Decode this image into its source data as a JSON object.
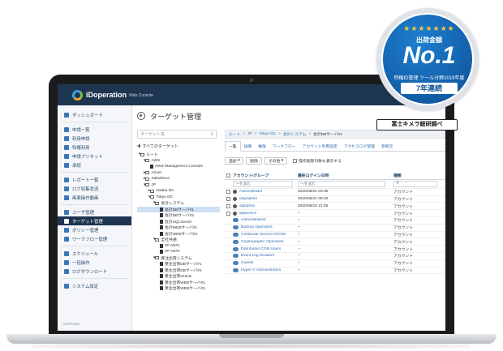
{
  "app": {
    "logo_text": "iDoperation",
    "logo_sub": "Web Console",
    "page_title": "ターゲット管理"
  },
  "sidebar": {
    "items": [
      {
        "label": "ダッシュボード"
      },
      {
        "label": "申請一覧"
      },
      {
        "label": "利用申請"
      },
      {
        "label": "特権利用"
      },
      {
        "label": "申請プリセット"
      },
      {
        "label": "承認"
      },
      {
        "label": "レポート一覧"
      },
      {
        "label": "ログ収集状況"
      },
      {
        "label": "画面操作動画"
      },
      {
        "label": "ユーザ管理"
      },
      {
        "label": "ターゲット管理"
      },
      {
        "label": "ポリシー管理"
      },
      {
        "label": "ワークフロー管理"
      },
      {
        "label": "スケジュール"
      },
      {
        "label": "一括操作"
      },
      {
        "label": "ログダウンロード"
      },
      {
        "label": "システム設定"
      }
    ],
    "footer": "Asia/Tokyo"
  },
  "tree": {
    "search_placeholder": "ターゲット名",
    "all_targets": "すべてのターゲット",
    "rows": [
      {
        "label": "ルート"
      },
      {
        "label": "AWS"
      },
      {
        "label": "AWS Management Console"
      },
      {
        "label": "Azure"
      },
      {
        "label": "Salesforce"
      },
      {
        "label": "JP"
      },
      {
        "label": "Osaka DC"
      },
      {
        "label": "Tokyo DC"
      },
      {
        "label": "会計システム"
      },
      {
        "label": "会計DBサーバ#1"
      },
      {
        "label": "会計DBサーバ#2"
      },
      {
        "label": "会計SQLServer"
      },
      {
        "label": "会計WEBサーバ#1"
      },
      {
        "label": "会計WEBサーバ#2"
      },
      {
        "label": "全社共通"
      },
      {
        "label": "JP AD#1"
      },
      {
        "label": "JP AD#2"
      },
      {
        "label": "受注出荷システム"
      },
      {
        "label": "受注出荷DBサーバ#1"
      },
      {
        "label": "受注出荷DBサーバ#2"
      },
      {
        "label": "受注出荷Oracle"
      },
      {
        "label": "受注出荷WEBサーバ#1"
      },
      {
        "label": "受注出荷WEBサーバ#2"
      }
    ]
  },
  "breadcrumb": [
    "ルート",
    "JP",
    "Tokyo DC",
    "会計システム",
    "会計DBサーバ#1"
  ],
  "tabs": [
    "一覧",
    "詳細",
    "権限",
    "ワークフロー",
    "アカウント利用設定",
    "アクセスログ管理",
    "参照元"
  ],
  "toolbar": {
    "add": "追加",
    "delete": "削除",
    "other": "その他",
    "show_deleted": "操作削除対象も表示する"
  },
  "grid": {
    "headers": [
      "アカウント/グループ",
      "最終ログイン日時",
      "種類"
    ],
    "filter_placeholder": "〜を含む",
    "filter_placeholder_2": "〜を含む",
    "rows": [
      {
        "name": "Administrator",
        "date": "2020/08/21 03:35",
        "type": "アカウント"
      },
      {
        "name": "idopadmin",
        "date": "2020/08/21 08:30",
        "type": "アカウント"
      },
      {
        "name": "sqladmin",
        "date": "2020/08/15 21:05",
        "type": "アカウント"
      },
      {
        "name": "sqlservice",
        "date": "--",
        "type": "アカウント"
      },
      {
        "name": "Administrators",
        "date": "--",
        "type": "アカウント"
      },
      {
        "name": "Backup Operators",
        "date": "--",
        "type": "アカウント"
      },
      {
        "name": "Certificate Service DCOM",
        "date": "--",
        "type": "アカウント"
      },
      {
        "name": "Cryptographic Operators",
        "date": "--",
        "type": "アカウント"
      },
      {
        "name": "Distributed COM Users",
        "date": "--",
        "type": "アカウント"
      },
      {
        "name": "Event Log Readers",
        "date": "--",
        "type": "アカウント"
      },
      {
        "name": "Guests",
        "date": "--",
        "type": "アカウント"
      },
      {
        "name": "Hyper-V Administrators",
        "date": "--",
        "type": "アカウント"
      }
    ]
  },
  "badge": {
    "line1": "出荷金額",
    "no1": "No.1",
    "line2": "特権ID管理 ツール分野2019年度",
    "line3": "7年連続",
    "source": "富士キメラ総研調べ",
    "star_color": "#f6c73d",
    "accent": "#0e4f96"
  }
}
